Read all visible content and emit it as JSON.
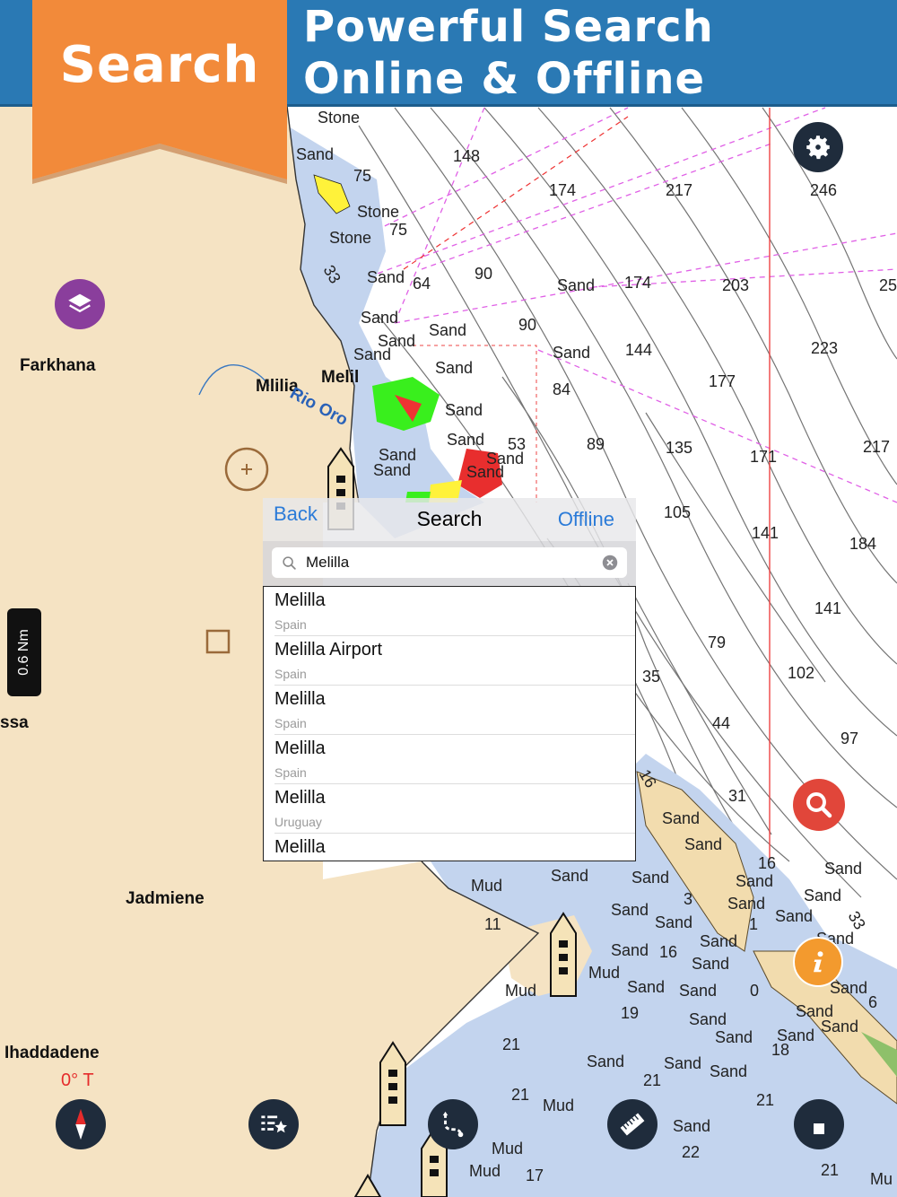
{
  "banner": {
    "ribbon_label": "Search",
    "title_line1": "Powerful Search",
    "title_line2": "Online & Offline"
  },
  "map": {
    "places": [
      "Farkhana",
      "Mlilia",
      "Melil",
      "Rio Oro",
      "ssa",
      "Jadmiene",
      "Ihaddadene"
    ],
    "depths": [
      "148",
      "174",
      "217",
      "246",
      "90",
      "174",
      "203",
      "25",
      "64",
      "75",
      "75",
      "90",
      "144",
      "223",
      "84",
      "177",
      "89",
      "135",
      "171",
      "217",
      "53",
      "105",
      "141",
      "184",
      "141",
      "79",
      "102",
      "35",
      "44",
      "97",
      "31",
      "16",
      "3",
      "1",
      "16",
      "19",
      "21",
      "21",
      "21",
      "18",
      "6",
      "22",
      "17",
      "21",
      "11",
      "16",
      "33",
      "33",
      "0"
    ],
    "seabed_labels": [
      "Stone",
      "Sand",
      "Stone",
      "Stone",
      "Sand",
      "Sand",
      "Sand",
      "Sand",
      "Sand",
      "Sand",
      "Sand",
      "Sand",
      "Sand",
      "Sand",
      "Sand",
      "Sand",
      "Sand",
      "Sand",
      "Sand",
      "Mud",
      "Mud",
      "Mud",
      "Mud",
      "Mud",
      "Mud",
      "Sand"
    ],
    "heading": "0° T",
    "scale": "0.6 Nm",
    "colors": {
      "land": "#f5e3c3",
      "deep_water": "#ffffff",
      "shallow_water": "#c3d4ee",
      "banner": "#2a79b4",
      "ribbon": "#f28a3a"
    }
  },
  "search_panel": {
    "back_label": "Back",
    "title": "Search",
    "offline_label": "Offline",
    "query": "Melilla",
    "results": [
      {
        "name": "Melilla",
        "country": "Spain"
      },
      {
        "name": "Melilla Airport",
        "country": "Spain"
      },
      {
        "name": "Melilla",
        "country": "Spain"
      },
      {
        "name": "Melilla",
        "country": "Spain"
      },
      {
        "name": "Melilla",
        "country": "Uruguay"
      },
      {
        "name": "Melilla",
        "country": ""
      }
    ]
  },
  "icons": [
    "settings-gear-icon",
    "layers-icon",
    "search-icon",
    "info-icon",
    "compass-icon",
    "favorites-list-icon",
    "route-icon",
    "ruler-icon",
    "stop-icon",
    "search-glass-icon",
    "clear-icon",
    "center-target-icon"
  ]
}
